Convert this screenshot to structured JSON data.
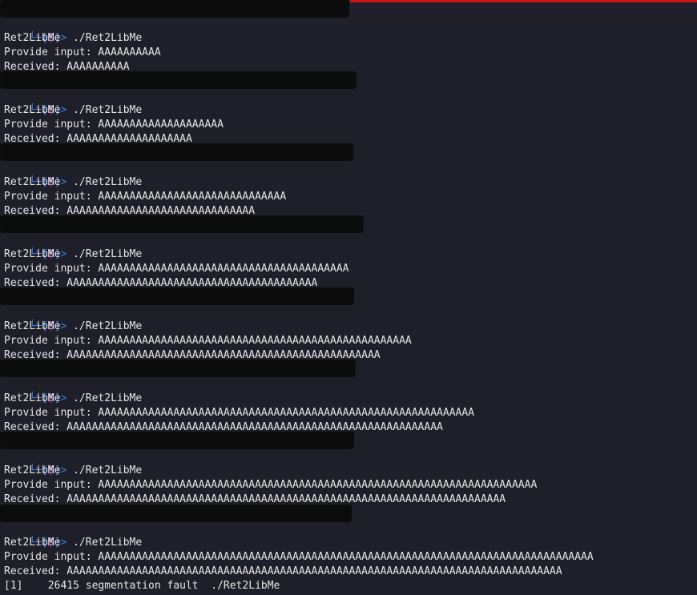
{
  "terminal": {
    "prompt": {
      "corner": "└─",
      "open_bracket": "[",
      "symbol": "$",
      "close_bracket": "]>"
    },
    "runs": [
      {
        "command": "./Ret2LibMe",
        "banner": "Ret2LibMe",
        "input_line": "Provide input: AAAAAAAAAA",
        "received_line": "Received: AAAAAAAAAA"
      },
      {
        "command": "./Ret2LibMe",
        "banner": "Ret2LibMe",
        "input_line": "Provide input: AAAAAAAAAAAAAAAAAAAA",
        "received_line": "Received: AAAAAAAAAAAAAAAAAAAA"
      },
      {
        "command": "./Ret2LibMe",
        "banner": "Ret2LibMe",
        "input_line": "Provide input: AAAAAAAAAAAAAAAAAAAAAAAAAAAAAA",
        "received_line": "Received: AAAAAAAAAAAAAAAAAAAAAAAAAAAAAA"
      },
      {
        "command": "./Ret2LibMe",
        "banner": "Ret2LibMe",
        "input_line": "Provide input: AAAAAAAAAAAAAAAAAAAAAAAAAAAAAAAAAAAAAAAA",
        "received_line": "Received: AAAAAAAAAAAAAAAAAAAAAAAAAAAAAAAAAAAAAAAA"
      },
      {
        "command": "./Ret2LibMe",
        "banner": "Ret2LibMe",
        "input_line": "Provide input: AAAAAAAAAAAAAAAAAAAAAAAAAAAAAAAAAAAAAAAAAAAAAAAAAA",
        "received_line": "Received: AAAAAAAAAAAAAAAAAAAAAAAAAAAAAAAAAAAAAAAAAAAAAAAAAA"
      },
      {
        "command": "./Ret2LibMe",
        "banner": "Ret2LibMe",
        "input_line": "Provide input: AAAAAAAAAAAAAAAAAAAAAAAAAAAAAAAAAAAAAAAAAAAAAAAAAAAAAAAAAAAA",
        "received_line": "Received: AAAAAAAAAAAAAAAAAAAAAAAAAAAAAAAAAAAAAAAAAAAAAAAAAAAAAAAAAAAA"
      },
      {
        "command": "./Ret2LibMe",
        "banner": "Ret2LibMe",
        "input_line": "Provide input: AAAAAAAAAAAAAAAAAAAAAAAAAAAAAAAAAAAAAAAAAAAAAAAAAAAAAAAAAAAAAAAAAAAAAA",
        "received_line": "Received: AAAAAAAAAAAAAAAAAAAAAAAAAAAAAAAAAAAAAAAAAAAAAAAAAAAAAAAAAAAAAAAAAAAAAA"
      },
      {
        "command": "./Ret2LibMe",
        "banner": "Ret2LibMe",
        "input_line": "Provide input: AAAAAAAAAAAAAAAAAAAAAAAAAAAAAAAAAAAAAAAAAAAAAAAAAAAAAAAAAAAAAAAAAAAAAAAAAAAAAAA",
        "received_line": "Received: AAAAAAAAAAAAAAAAAAAAAAAAAAAAAAAAAAAAAAAAAAAAAAAAAAAAAAAAAAAAAAAAAAAAAAAAAAAAAAA"
      }
    ],
    "segfault_line": "[1]    26415 segmentation fault  ./Ret2LibMe"
  },
  "colors": {
    "background": "#1e1f29",
    "text": "#e6e6e6",
    "prompt_blue": "#3a7de0",
    "prompt_purple": "#c678dd",
    "redaction": "#0c0c0c",
    "top_accent": "#cc1616"
  }
}
